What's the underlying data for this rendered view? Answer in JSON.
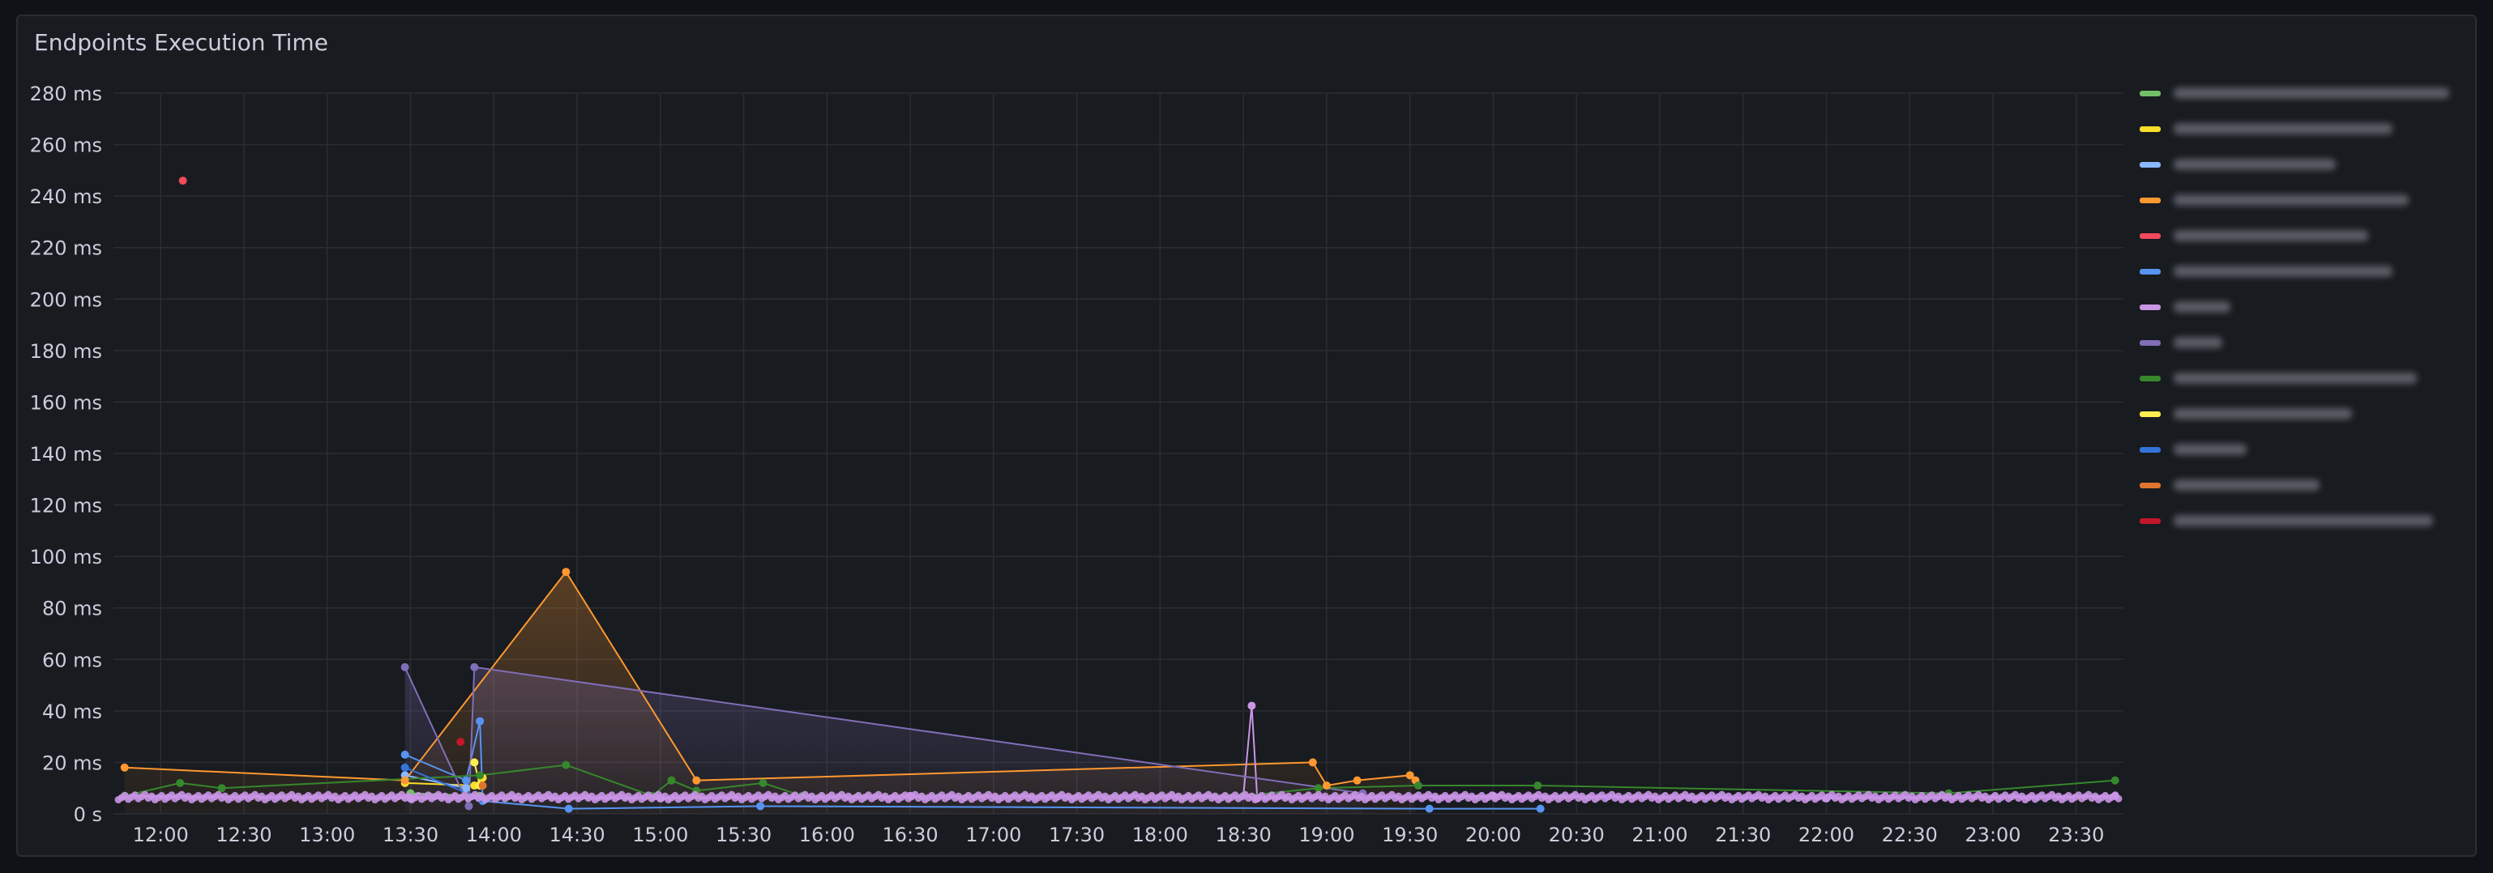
{
  "panel": {
    "title": "Endpoints Execution Time"
  },
  "chart_data": {
    "type": "line",
    "ylim": [
      0,
      280
    ],
    "y_ticks": [
      {
        "value": 280,
        "label": "280 ms"
      },
      {
        "value": 260,
        "label": "260 ms"
      },
      {
        "value": 240,
        "label": "240 ms"
      },
      {
        "value": 220,
        "label": "220 ms"
      },
      {
        "value": 200,
        "label": "200 ms"
      },
      {
        "value": 180,
        "label": "180 ms"
      },
      {
        "value": 160,
        "label": "160 ms"
      },
      {
        "value": 140,
        "label": "140 ms"
      },
      {
        "value": 120,
        "label": "120 ms"
      },
      {
        "value": 100,
        "label": "100 ms"
      },
      {
        "value": 80,
        "label": "80 ms"
      },
      {
        "value": 60,
        "label": "60 ms"
      },
      {
        "value": 40,
        "label": "40 ms"
      },
      {
        "value": 20,
        "label": "20 ms"
      },
      {
        "value": 0,
        "label": "0 s"
      }
    ],
    "xlim": [
      "11:43",
      "23:47"
    ],
    "x_ticks": [
      "12:00",
      "12:30",
      "13:00",
      "13:30",
      "14:00",
      "14:30",
      "15:00",
      "15:30",
      "16:00",
      "16:30",
      "17:00",
      "17:30",
      "18:00",
      "18:30",
      "19:00",
      "19:30",
      "20:00",
      "20:30",
      "21:00",
      "21:30",
      "22:00",
      "22:30",
      "23:00",
      "23:30"
    ],
    "grid": true,
    "legend_position": "right",
    "series": [
      {
        "color": "#73bf69",
        "points": [
          [
            "13:30",
            8
          ],
          [
            "13:55",
            7
          ]
        ]
      },
      {
        "color": "#fade2a",
        "points": [
          [
            "13:28",
            12
          ],
          [
            "13:53",
            11
          ],
          [
            "13:56",
            14
          ]
        ]
      },
      {
        "color": "#8ab8ff",
        "points": [
          [
            "13:28",
            15
          ],
          [
            "13:50",
            10
          ]
        ]
      },
      {
        "color": "#ff9830",
        "fill": true,
        "points": [
          [
            "11:47",
            18
          ],
          [
            "13:28",
            13
          ],
          [
            "14:26",
            94
          ],
          [
            "15:13",
            13
          ],
          [
            "18:55",
            20
          ],
          [
            "19:00",
            11
          ],
          [
            "19:11",
            13
          ],
          [
            "19:30",
            15
          ],
          [
            "19:32",
            13
          ]
        ]
      },
      {
        "color": "#f2495c",
        "points": [
          [
            "12:08",
            246
          ]
        ]
      },
      {
        "color": "#5794f2",
        "points": [
          [
            "13:28",
            23
          ],
          [
            "13:50",
            13
          ],
          [
            "13:55",
            36
          ],
          [
            "13:56",
            5
          ],
          [
            "14:27",
            2
          ],
          [
            "15:36",
            3
          ],
          [
            "19:37",
            2
          ],
          [
            "20:17",
            2
          ]
        ]
      },
      {
        "color": "#ca95e5",
        "points": [
          [
            "11:47",
            7
          ],
          [
            "13:30",
            6
          ],
          [
            "15:00",
            6
          ],
          [
            "16:30",
            7
          ],
          [
            "18:30",
            7
          ],
          [
            "18:33",
            42
          ],
          [
            "18:35",
            6
          ],
          [
            "20:00",
            7
          ],
          [
            "22:00",
            6
          ],
          [
            "23:44",
            7
          ]
        ]
      },
      {
        "color": "#806eb7",
        "fill": true,
        "points": [
          [
            "13:28",
            57
          ],
          [
            "13:51",
            3
          ],
          [
            "13:53",
            57
          ],
          [
            "19:13",
            8
          ]
        ]
      },
      {
        "color": "#37872d",
        "points": [
          [
            "11:47",
            7
          ],
          [
            "12:07",
            12
          ],
          [
            "12:22",
            10
          ],
          [
            "13:55",
            15
          ],
          [
            "14:26",
            19
          ],
          [
            "14:57",
            7
          ],
          [
            "15:04",
            13
          ],
          [
            "15:13",
            9
          ],
          [
            "15:37",
            12
          ],
          [
            "15:51",
            7
          ],
          [
            "18:30",
            7
          ],
          [
            "18:57",
            10
          ],
          [
            "19:33",
            11
          ],
          [
            "20:16",
            11
          ],
          [
            "22:44",
            8
          ],
          [
            "23:44",
            13
          ]
        ]
      },
      {
        "color": "#ffee52",
        "points": [
          [
            "13:53",
            20
          ],
          [
            "13:55",
            11
          ]
        ]
      },
      {
        "color": "#3274d9",
        "points": [
          [
            "13:28",
            18
          ],
          [
            "13:55",
            6
          ]
        ]
      },
      {
        "color": "#e0752d",
        "points": [
          [
            "13:56",
            11
          ]
        ]
      },
      {
        "color": "#c4162a",
        "points": [
          [
            "13:48",
            28
          ]
        ]
      }
    ]
  }
}
